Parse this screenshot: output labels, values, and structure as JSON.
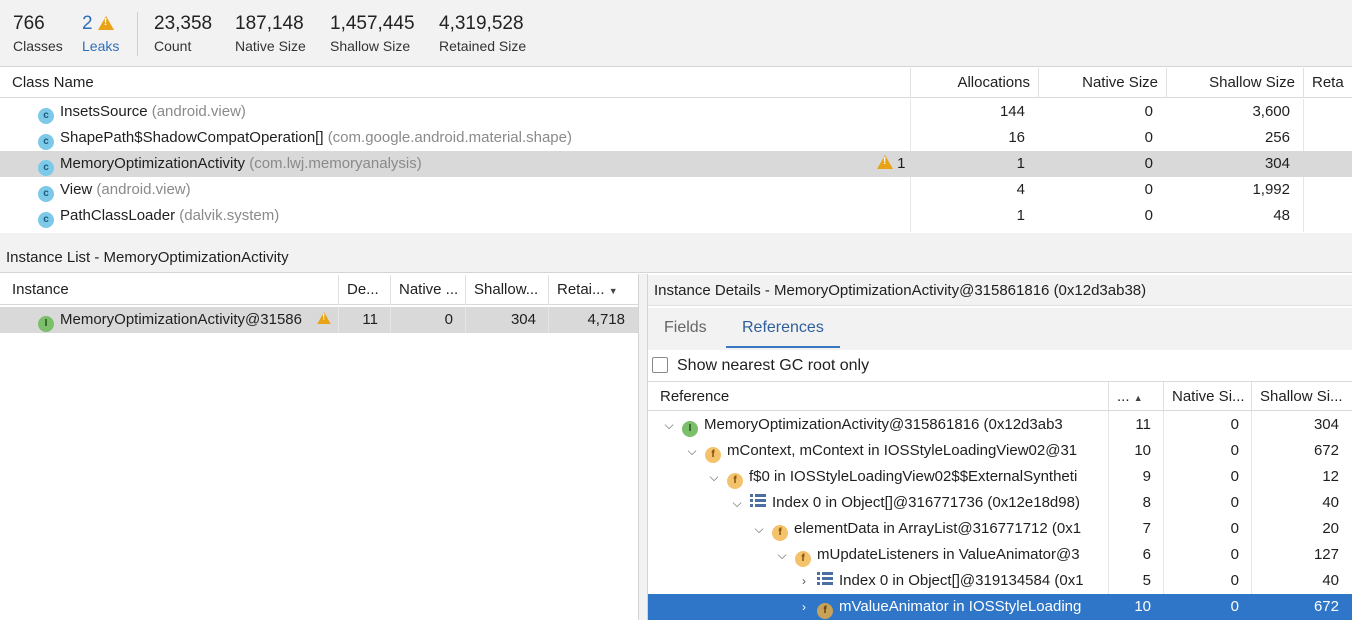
{
  "summary": {
    "classes": {
      "value": "766",
      "label": "Classes"
    },
    "leaks": {
      "value": "2",
      "label": "Leaks"
    },
    "count": {
      "value": "23,358",
      "label": "Count"
    },
    "native_size": {
      "value": "187,148",
      "label": "Native Size"
    },
    "shallow_size": {
      "value": "1,457,445",
      "label": "Shallow Size"
    },
    "retained_size": {
      "value": "4,319,528",
      "label": "Retained Size"
    }
  },
  "class_table": {
    "headers": [
      "Class Name",
      "Allocations",
      "Native Size",
      "Shallow Size",
      "Reta"
    ],
    "rows": [
      {
        "name": "InsetsSource",
        "pkg": "(android.view)",
        "leak": "",
        "alloc": "144",
        "native": "0",
        "shallow": "3,600"
      },
      {
        "name": "ShapePath$ShadowCompatOperation[]",
        "pkg": "(com.google.android.material.shape)",
        "leak": "",
        "alloc": "16",
        "native": "0",
        "shallow": "256"
      },
      {
        "name": "MemoryOptimizationActivity",
        "pkg": "(com.lwj.memoryanalysis)",
        "leak": "1",
        "alloc": "1",
        "native": "0",
        "shallow": "304"
      },
      {
        "name": "View",
        "pkg": "(android.view)",
        "leak": "",
        "alloc": "4",
        "native": "0",
        "shallow": "1,992"
      },
      {
        "name": "PathClassLoader",
        "pkg": "(dalvik.system)",
        "leak": "",
        "alloc": "1",
        "native": "0",
        "shallow": "48"
      }
    ]
  },
  "instance_list": {
    "title": "Instance List - MemoryOptimizationActivity",
    "headers": [
      "Instance",
      "De...",
      "Native ...",
      "Shallow...",
      "Retai..."
    ],
    "rows": [
      {
        "name": "MemoryOptimizationActivity@31586",
        "depth": "11",
        "native": "0",
        "shallow": "304",
        "retained": "4,718"
      }
    ]
  },
  "instance_details": {
    "title": "Instance Details - MemoryOptimizationActivity@315861816 (0x12d3ab38)",
    "tabs": [
      "Fields",
      "References"
    ],
    "active_tab": "References",
    "gc_root_checkbox_label": "Show nearest GC root only",
    "gc_root_checked": false,
    "headers": [
      "Reference",
      "...",
      "Native Si...",
      "Shallow Si..."
    ],
    "rows": [
      {
        "icon": "instance",
        "chevron": "down",
        "text": "MemoryOptimizationActivity@315861816 (0x12d3ab3",
        "depth": "11",
        "native": "0",
        "shallow": "304"
      },
      {
        "icon": "field",
        "chevron": "down",
        "text": "mContext, mContext in IOSStyleLoadingView02@31",
        "depth": "10",
        "native": "0",
        "shallow": "672"
      },
      {
        "icon": "field",
        "chevron": "down",
        "text": "f$0 in IOSStyleLoadingView02$$ExternalSyntheti",
        "depth": "9",
        "native": "0",
        "shallow": "12"
      },
      {
        "icon": "index",
        "chevron": "down",
        "text": "Index 0 in Object[]@316771736 (0x12e18d98)",
        "depth": "8",
        "native": "0",
        "shallow": "40"
      },
      {
        "icon": "field",
        "chevron": "down",
        "text": "elementData in ArrayList@316771712 (0x1",
        "depth": "7",
        "native": "0",
        "shallow": "20"
      },
      {
        "icon": "field",
        "chevron": "down",
        "text": "mUpdateListeners in ValueAnimator@3",
        "depth": "6",
        "native": "0",
        "shallow": "127"
      },
      {
        "icon": "index",
        "chevron": "right",
        "text": "Index 0 in Object[]@319134584 (0x1",
        "depth": "5",
        "native": "0",
        "shallow": "40"
      },
      {
        "icon": "field",
        "chevron": "right",
        "text": "mValueAnimator in IOSStyleLoading",
        "depth": "10",
        "native": "0",
        "shallow": "672"
      }
    ]
  },
  "colors": {
    "accent": "#2f76c8",
    "warning": "#e8a317",
    "selected_gray": "#d9d9d9"
  }
}
